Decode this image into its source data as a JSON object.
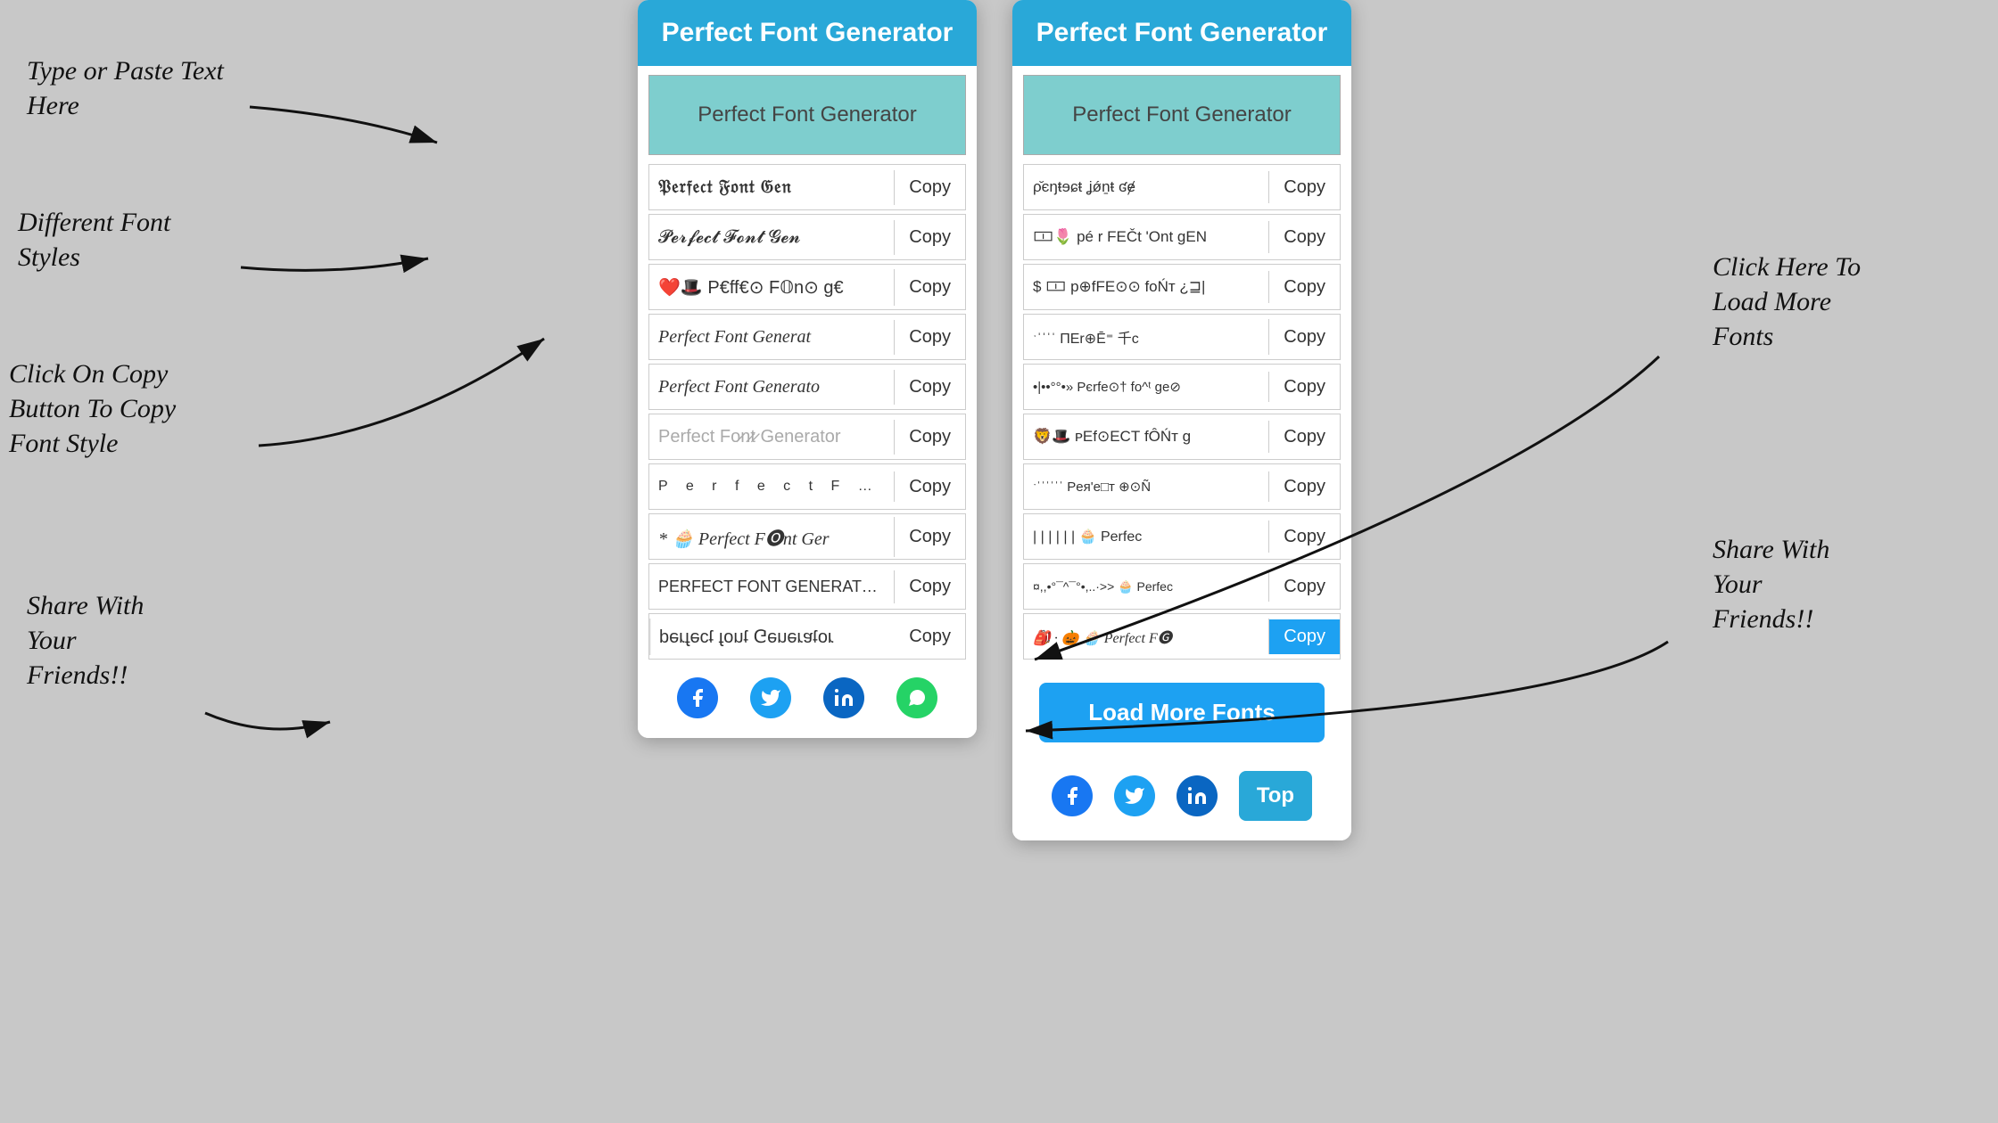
{
  "app": {
    "title": "Perfect Font Generator",
    "input_placeholder": "Perfect Font Generator"
  },
  "annotations": {
    "type_paste": "Type or Paste Text\nHere",
    "different_fonts": "Different Font\nStyles",
    "click_copy": "Click On Copy\nButton To Copy\nFont Style",
    "share": "Share With\nYour\nFriends!!",
    "load_more_label": "Click Here To\nLoad More\nFonts",
    "share_right": "Share With\nYour\nFriends!!"
  },
  "phone1": {
    "header": "Perfect Font Generator",
    "input_value": "Perfect Font Generator",
    "fonts": [
      {
        "text": "𝔓𝔢𝔯𝔣𝔢𝔠𝔱 𝔉𝔬𝔫𝔱 𝔊𝔢𝔫𝔢𝔯𝔞𝔱𝔬𝔯",
        "copy": "Copy"
      },
      {
        "text": "𝓟𝓮𝓻𝓯𝓮𝓬𝓽 𝓕𝓸𝓷𝓽 𝓖𝓮𝓷𝓮𝓻𝓪𝓽𝓸𝓻",
        "copy": "Copy"
      },
      {
        "text": "❤️🎩 P€ff€⊙ F𝕆n⊙ g€",
        "copy": "Copy"
      },
      {
        "text": "Perfect Font Generat",
        "copy": "Copy"
      },
      {
        "text": "Perfect Font Generato",
        "copy": "Copy"
      },
      {
        "text": "Perfect Fo̷n̷t̷ Generator",
        "copy": "Copy"
      },
      {
        "text": "P e r f e c t  F o n t",
        "copy": "Copy"
      },
      {
        "text": "* 🧁 Perfect F🅞nt Ger",
        "copy": "Copy"
      },
      {
        "text": "PERFECT FONT GENERATOR",
        "copy": "Copy"
      },
      {
        "text": "ɹoʇɐɹǝuǝ⅁ ʇuoɟ ʇɔǝɟɹǝd",
        "copy": "Copy"
      }
    ],
    "social": [
      "facebook",
      "twitter",
      "linkedin",
      "whatsapp"
    ]
  },
  "phone2": {
    "header": "Perfect Font Generator",
    "input_value": "Perfect Font Generator",
    "fonts": [
      {
        "text": "ρ̆є⊓ŧɘɕŧ͟ ʝǿṉŧ ʛɇ",
        "copy": "Copy"
      },
      {
        "text": "🀱🌷 pé r FEČt 'Ont gEN",
        "copy": "Copy"
      },
      {
        "text": "$ 🀱 p⊕fFE⊙⊙ foŃт ¿⊒|",
        "copy": "Copy"
      },
      {
        "text": "ˑˈˈˈˈ ΠЕr⊕Ē⁼ 千c",
        "copy": "Copy"
      },
      {
        "text": "•|••°°•» Pєrfe⊙† fo^ᵗ ge⊘",
        "copy": "Copy"
      },
      {
        "text": "🦁🎩 ᴘEf⊙ЕCТ fÔŃт g",
        "copy": "Copy"
      },
      {
        "text": "ˑˈˈˈˈˈˈ Pея'е□т ⊕⊙Ñ",
        "copy": "Copy"
      },
      {
        "text": "| | |  |  | |  🧁 Perfec",
        "copy": "Copy"
      },
      {
        "text": "¤,,•°¯^¯°•,..·>> 🧁 Perfec",
        "copy": "Copy"
      },
      {
        "text": "🎒 · 🎃 🧁 Perfect F🅖",
        "copy": "Copy"
      }
    ],
    "buttons": {
      "load_more": "Load More Fonts",
      "top": "Top"
    },
    "social": [
      "facebook",
      "twitter",
      "linkedin"
    ]
  },
  "copy_label": "Copy",
  "colors": {
    "header_bg": "#29a8d8",
    "input_bg": "#7ecece",
    "load_more_bg": "#1da1f2",
    "top_bg": "#29a8d8",
    "facebook": "#1877f2",
    "twitter": "#1da1f2",
    "linkedin": "#0a66c2",
    "whatsapp": "#25d366"
  }
}
